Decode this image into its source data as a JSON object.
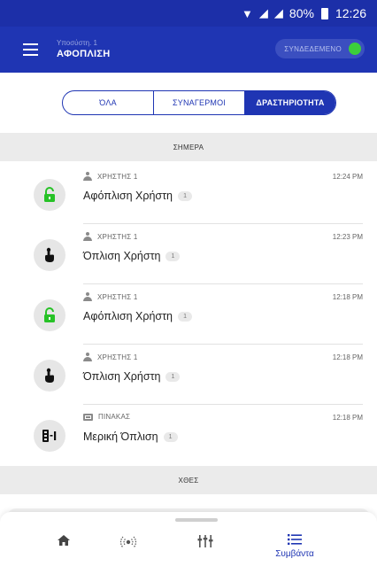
{
  "status_bar": {
    "battery": "80%",
    "time": "12:26"
  },
  "header": {
    "subtitle": "Υποσύστη. 1",
    "title": "ΑΦΟΠΛΙΣΗ",
    "connection": "ΣΥΝΔΕΔΕΜΕΝΟ"
  },
  "tabs": [
    {
      "label": "ΌΛΑ"
    },
    {
      "label": "ΣΥΝΑΓΕΡΜΟΙ"
    },
    {
      "label": "ΔΡΑΣΤΗΡΙΟΤΗΤΑ"
    }
  ],
  "sections": {
    "today": "ΣΗΜΕΡΑ",
    "yesterday": "ΧΘΕΣ"
  },
  "events": [
    {
      "source": "ΧΡΗΣΤΗΣ 1",
      "description": "Αφόπλιση Χρήστη",
      "badge": "1",
      "time": "12:24 PM",
      "icon": "unlock-icon"
    },
    {
      "source": "ΧΡΗΣΤΗΣ 1",
      "description": "Όπλιση Χρήστη",
      "badge": "1",
      "time": "12:23 PM",
      "icon": "keypad-touch-icon"
    },
    {
      "source": "ΧΡΗΣΤΗΣ 1",
      "description": "Αφόπλιση Χρήστη",
      "badge": "1",
      "time": "12:18 PM",
      "icon": "unlock-icon"
    },
    {
      "source": "ΧΡΗΣΤΗΣ 1",
      "description": "Όπλιση Χρήστη",
      "badge": "1",
      "time": "12:18 PM",
      "icon": "keypad-touch-icon"
    },
    {
      "source": "ΠΙΝΑΚΑΣ",
      "description": "Μερική Όπλιση",
      "badge": "1",
      "time": "12:18 PM",
      "icon": "partial-arm-icon"
    }
  ],
  "bottom_nav": {
    "items": [
      {
        "icon": "home-icon"
      },
      {
        "icon": "sensors-icon"
      },
      {
        "icon": "sliders-icon"
      },
      {
        "icon": "events-list-icon",
        "label": "Συμβάντα"
      }
    ]
  },
  "colors": {
    "primary": "#1f35b3",
    "status_bar": "#1c2fa8",
    "connected": "#3ccf3c",
    "unlock_green": "#27c227"
  }
}
